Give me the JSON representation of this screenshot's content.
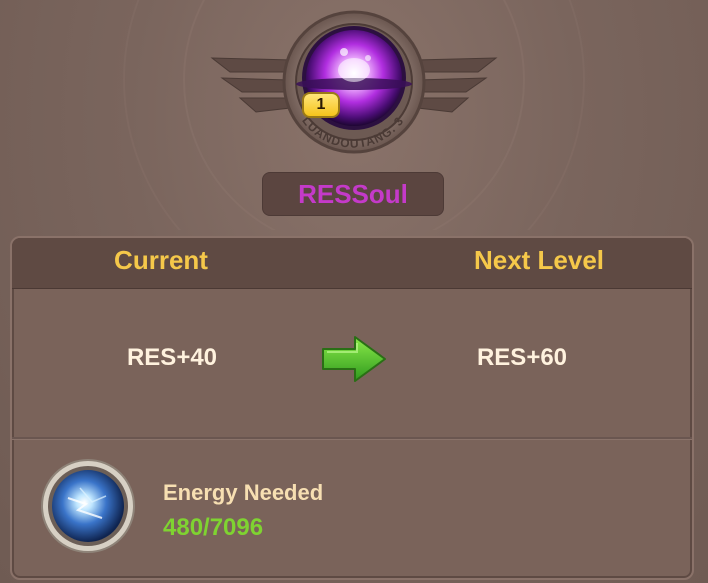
{
  "header": {
    "level_badge": "1",
    "ring_text": "LUANDOUTANG. 3",
    "soul_name": "RESSoul",
    "soul_name_color": "#c43ac9"
  },
  "panel": {
    "current_label": "Current",
    "next_label": "Next Level",
    "current_stat": "RES+40",
    "next_stat": "RES+60",
    "arrow_icon": "green-right-arrow"
  },
  "energy": {
    "label": "Energy Needed",
    "value": "480/7096",
    "value_color": "#7fd331",
    "icon": "blue-energy-orb"
  }
}
